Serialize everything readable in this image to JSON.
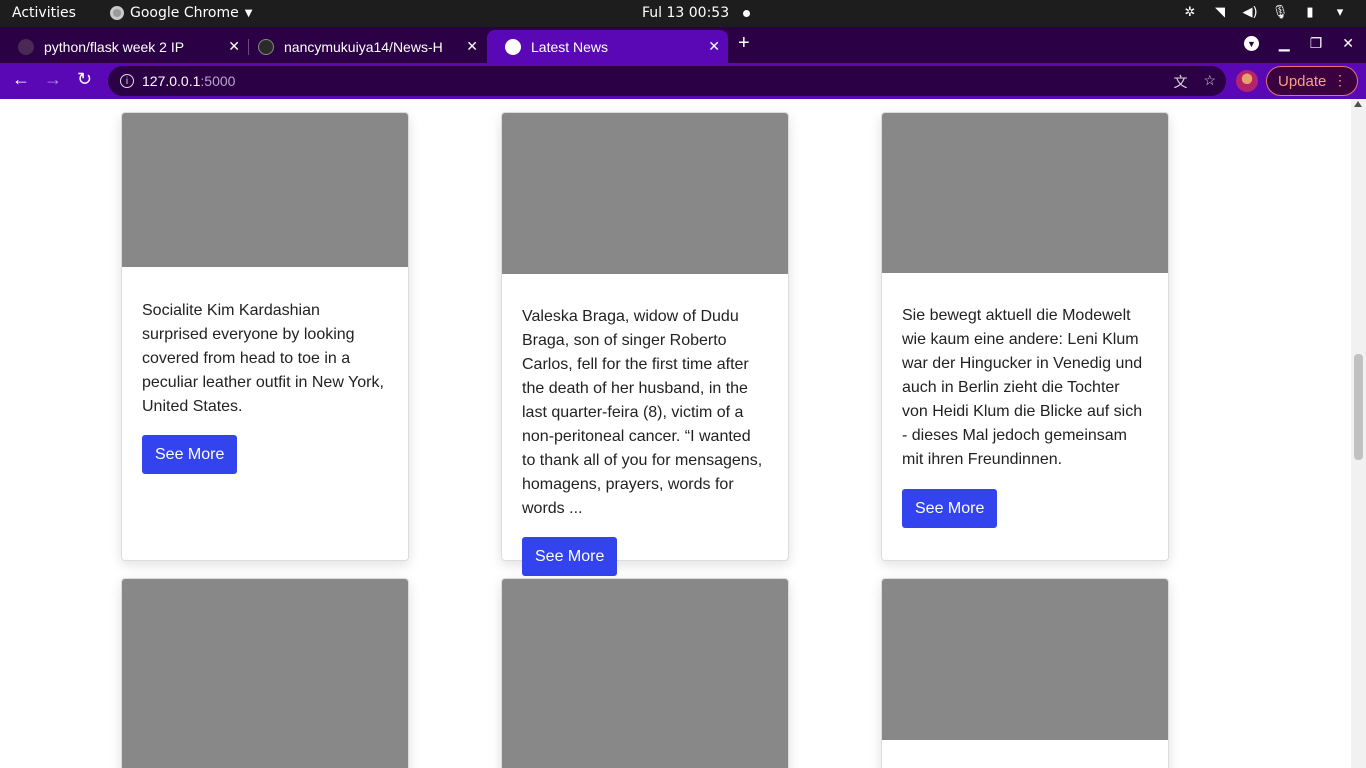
{
  "system": {
    "activities": "Activities",
    "app_name": "Google Chrome",
    "clock": "Ful 13  00:53"
  },
  "browser": {
    "tabs": [
      {
        "title": "python/flask week 2 IP",
        "active": false,
        "icon": "document-icon"
      },
      {
        "title": "nancymukuiya14/News-H",
        "active": false,
        "icon": "github-icon"
      },
      {
        "title": "Latest News",
        "active": true,
        "icon": "globe-icon"
      }
    ],
    "url_host": "127.0.0.1",
    "url_port": ":5000",
    "update_label": "Update",
    "colors": {
      "tabstrip": "#2b0045",
      "toolbar": "#5a08b5"
    }
  },
  "articles": [
    {
      "description": "Socialite Kim Kardashian surprised everyone by looking covered from head to toe in a peculiar leather outfit in New York, United States.",
      "button": "See More"
    },
    {
      "description": "Valeska Braga, widow of Dudu Braga, son of singer Roberto Carlos, fell for the first time after the death of her husband, in the last quarter-feira (8), victim of a non-peritoneal cancer. “I wanted to thank all of you for mensagens, homagens, prayers, words for words ...",
      "button": "See More"
    },
    {
      "description": "Sie bewegt aktuell die Modewelt wie kaum eine andere: Leni Klum war der Hingucker in Venedig und auch in Berlin zieht die Tochter von Heidi Klum die Blicke auf sich - dieses Mal jedoch gemeinsam mit ihren Freundinnen.",
      "button": "See More"
    },
    {
      "description": "",
      "button": ""
    },
    {
      "description": "",
      "button": ""
    },
    {
      "description": "",
      "button": ""
    }
  ],
  "button_color": "#3344ee"
}
